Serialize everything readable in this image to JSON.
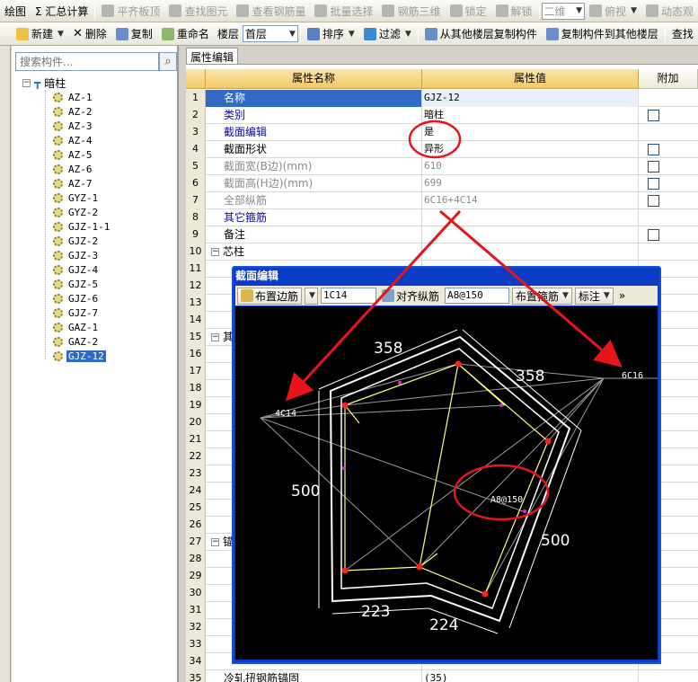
{
  "toolbar1": {
    "items": [
      {
        "label": "绘图",
        "disabled": false
      },
      {
        "label": "Σ 汇总计算",
        "disabled": false
      },
      {
        "label": "平齐板顶",
        "disabled": true
      },
      {
        "label": "查找图元",
        "disabled": true
      },
      {
        "label": "查看钢筋量",
        "disabled": true
      },
      {
        "label": "批量选择",
        "disabled": true
      },
      {
        "label": "钢筋三维",
        "disabled": true
      },
      {
        "label": "锁定",
        "disabled": true
      },
      {
        "label": "解锁",
        "disabled": true
      }
    ],
    "view_select": "二维",
    "view_mode": "俯视",
    "dynamic": "动态观"
  },
  "toolbar2": {
    "new_label": "新建",
    "delete_label": "删除",
    "copy_label": "复制",
    "rename_label": "重命名",
    "floor_label": "楼层",
    "floor_value": "首层",
    "sort_label": "排序",
    "filter_label": "过滤",
    "copy_from_floor_label": "从其他楼层复制构件",
    "copy_to_floor_label": "复制构件到其他楼层",
    "find_label": "查找"
  },
  "left_panel": {
    "search_placeholder": "搜索构件...",
    "root_label": "暗柱",
    "items": [
      "AZ-1",
      "AZ-2",
      "AZ-3",
      "AZ-4",
      "AZ-5",
      "AZ-6",
      "AZ-7",
      "GYZ-1",
      "GYZ-2",
      "GJZ-1-1",
      "GJZ-2",
      "GJZ-3",
      "GJZ-4",
      "GJZ-5",
      "GJZ-6",
      "GJZ-7",
      "GAZ-1",
      "GAZ-2",
      "GJZ-12"
    ],
    "selected_item": "GJZ-12"
  },
  "property_panel": {
    "tab_label": "属性编辑",
    "columns": {
      "name": "属性名称",
      "value": "属性值",
      "extra": "附加"
    },
    "rows": [
      {
        "num": "1",
        "name": "名称",
        "value": "GJZ-12",
        "style": "blue",
        "check": false
      },
      {
        "num": "2",
        "name": "类别",
        "value": "暗柱",
        "style": "blue",
        "check": true
      },
      {
        "num": "3",
        "name": "截面编辑",
        "value": "是",
        "style": "blue",
        "check": false
      },
      {
        "num": "4",
        "name": "截面形状",
        "value": "异形",
        "style": "black",
        "check": true
      },
      {
        "num": "5",
        "name": "截面宽(B边)(mm)",
        "value": "610",
        "style": "gray",
        "check": true
      },
      {
        "num": "6",
        "name": "截面高(H边)(mm)",
        "value": "699",
        "style": "gray",
        "check": true
      },
      {
        "num": "7",
        "name": "全部纵筋",
        "value": "6C16+4C14",
        "style": "gray",
        "check": true
      },
      {
        "num": "8",
        "name": "其它箍筋",
        "value": "",
        "style": "blue",
        "check": false
      },
      {
        "num": "9",
        "name": "备注",
        "value": "",
        "style": "black",
        "check": true
      },
      {
        "num": "10",
        "name": "芯柱",
        "value": "",
        "style": "group",
        "check": false
      },
      {
        "num": "11",
        "name": "",
        "value": "",
        "style": "black",
        "check": false
      },
      {
        "num": "12",
        "name": "",
        "value": "",
        "style": "black",
        "check": false
      },
      {
        "num": "13",
        "name": "",
        "value": "",
        "style": "black",
        "check": false
      },
      {
        "num": "14",
        "name": "",
        "value": "",
        "style": "black",
        "check": false
      },
      {
        "num": "15",
        "name": "其",
        "value": "",
        "style": "group",
        "check": false
      },
      {
        "num": "16",
        "name": "",
        "value": "",
        "style": "black",
        "check": false
      },
      {
        "num": "17",
        "name": "",
        "value": "",
        "style": "black",
        "check": false
      },
      {
        "num": "18",
        "name": "",
        "value": "",
        "style": "black",
        "check": false
      },
      {
        "num": "19",
        "name": "",
        "value": "",
        "style": "black",
        "check": false
      },
      {
        "num": "20",
        "name": "",
        "value": "",
        "style": "black",
        "check": false
      },
      {
        "num": "21",
        "name": "",
        "value": "",
        "style": "black",
        "check": false
      },
      {
        "num": "22",
        "name": "",
        "value": "",
        "style": "black",
        "check": false
      },
      {
        "num": "23",
        "name": "",
        "value": "",
        "style": "black",
        "check": false
      },
      {
        "num": "24",
        "name": "",
        "value": "",
        "style": "black",
        "check": false
      },
      {
        "num": "25",
        "name": "",
        "value": "",
        "style": "black",
        "check": false
      },
      {
        "num": "26",
        "name": "",
        "value": "",
        "style": "black",
        "check": false
      },
      {
        "num": "27",
        "name": "锚",
        "value": "",
        "style": "group",
        "check": false
      },
      {
        "num": "28",
        "name": "",
        "value": "",
        "style": "black",
        "check": false
      },
      {
        "num": "29",
        "name": "",
        "value": "",
        "style": "black",
        "check": false
      },
      {
        "num": "30",
        "name": "",
        "value": "",
        "style": "black",
        "check": false
      },
      {
        "num": "31",
        "name": "",
        "value": "",
        "style": "black",
        "check": false
      },
      {
        "num": "32",
        "name": "",
        "value": "",
        "style": "black",
        "check": false
      },
      {
        "num": "33",
        "name": "",
        "value": "",
        "style": "black",
        "check": false
      },
      {
        "num": "34",
        "name": "",
        "value": "",
        "style": "black",
        "check": false
      },
      {
        "num": "35",
        "name": "冷轧扭钢筋锚固",
        "value": "(35)",
        "style": "black",
        "check": false
      }
    ]
  },
  "dialog": {
    "title": "截面编辑",
    "edge_rebar_label": "布置边筋",
    "edge_rebar_value": "1C14",
    "align_rebar_label": "对齐纵筋",
    "stirrup_value": "A8@150",
    "place_stirrup_label": "布置箍筋",
    "annotate_label": "标注",
    "more_label": "»",
    "canvas_labels": {
      "dim_top_left": "358",
      "dim_top_right": "358",
      "dim_left": "500",
      "dim_right": "500",
      "dim_bottom_left": "223",
      "dim_bottom_right": "224",
      "rebar_left": "4C14",
      "rebar_right": "6C16",
      "stirrup_label": "A8@150"
    },
    "colors": {
      "outline": "#ffffff",
      "stirrup": "#ffff80",
      "rebar": "#ff2020",
      "leader": "#9a9a9a",
      "pink": "#d030d0"
    }
  },
  "annotations_color": "#e8141c"
}
